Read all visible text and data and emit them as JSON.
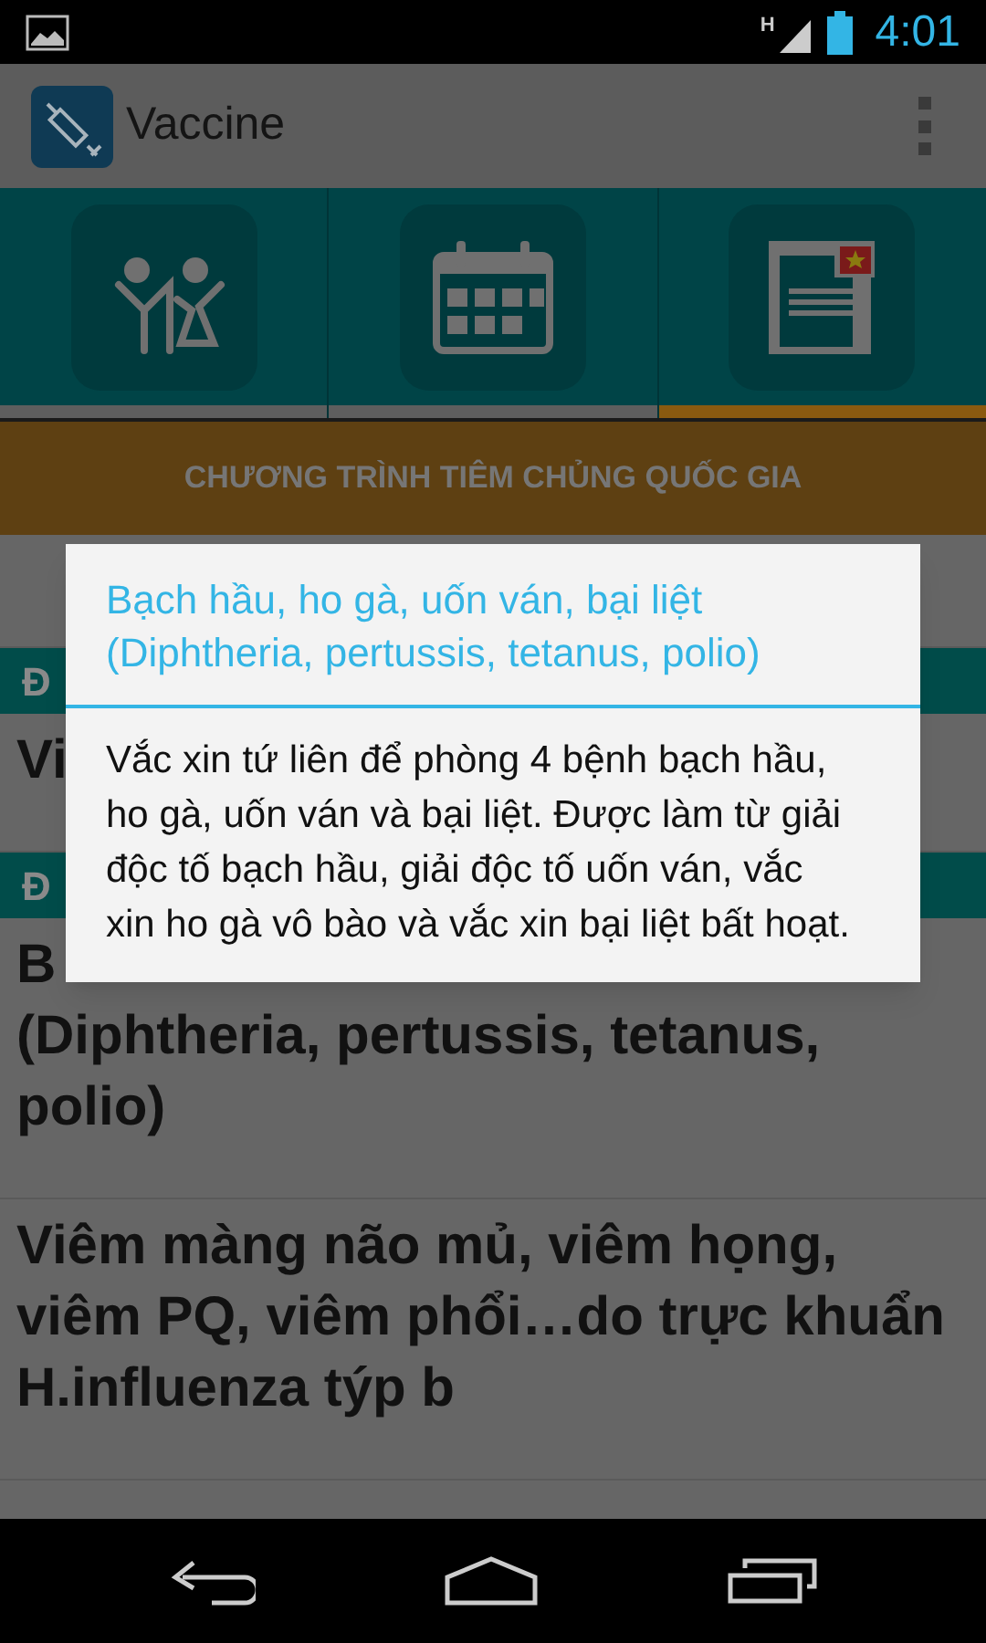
{
  "status_bar": {
    "time": "4:01",
    "network": "H"
  },
  "action_bar": {
    "title": "Vaccine"
  },
  "tabs": [
    {
      "kind": "people",
      "selected": false
    },
    {
      "kind": "calendar",
      "selected": false
    },
    {
      "kind": "document",
      "selected": true
    }
  ],
  "banner": "CHƯƠNG TRÌNH TIÊM CHỦNG QUỐC GIA",
  "list": [
    {
      "kind": "item"
    },
    {
      "kind": "header",
      "lines": [
        "Đ"
      ]
    },
    {
      "kind": "item",
      "lines": [
        "Vi"
      ]
    },
    {
      "kind": "header",
      "lines": [
        "Đ"
      ]
    },
    {
      "kind": "item",
      "lines": [
        "B",
        "(Diphtheria, pertussis, tetanus,",
        "polio)"
      ]
    },
    {
      "kind": "item",
      "lines": [
        "Viêm màng não mủ, viêm họng,",
        "viêm PQ, viêm phổi…do trực khuẩn",
        "H.influenza týp b"
      ]
    }
  ],
  "dialog": {
    "title": "Bạch hầu, ho gà, uốn ván, bại liệt (Diphtheria, pertussis, tetanus, polio)",
    "message": "Vắc xin tứ liên để phòng 4 bệnh bạch hầu, ho gà, uốn ván và bại liệt. Được làm từ giải độc tố bạch hầu, giải độc tố uốn ván, vắc xin ho gà vô bào và vắc xin bại liệt bất hoạt."
  }
}
